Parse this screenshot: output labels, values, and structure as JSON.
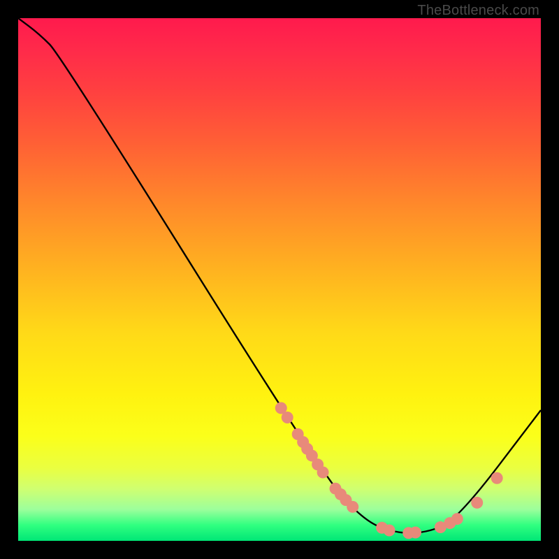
{
  "attribution": "TheBottleneck.com",
  "chart_data": {
    "type": "line",
    "title": "",
    "xlabel": "",
    "ylabel": "",
    "xlim": [
      0,
      100
    ],
    "ylim": [
      0,
      100
    ],
    "curve": [
      {
        "x": 0,
        "y": 100
      },
      {
        "x": 4,
        "y": 97
      },
      {
        "x": 8,
        "y": 93
      },
      {
        "x": 58,
        "y": 13
      },
      {
        "x": 66,
        "y": 4
      },
      {
        "x": 72,
        "y": 1.5
      },
      {
        "x": 78,
        "y": 1.5
      },
      {
        "x": 84,
        "y": 4
      },
      {
        "x": 100,
        "y": 25
      }
    ],
    "points": [
      {
        "x": 50.3,
        "y": 25.4
      },
      {
        "x": 51.5,
        "y": 23.6
      },
      {
        "x": 53.5,
        "y": 20.4
      },
      {
        "x": 54.5,
        "y": 18.9
      },
      {
        "x": 55.3,
        "y": 17.6
      },
      {
        "x": 56.2,
        "y": 16.3
      },
      {
        "x": 57.3,
        "y": 14.6
      },
      {
        "x": 58.3,
        "y": 13.1
      },
      {
        "x": 60.7,
        "y": 10.0
      },
      {
        "x": 61.7,
        "y": 8.9
      },
      {
        "x": 62.7,
        "y": 7.8
      },
      {
        "x": 64.0,
        "y": 6.5
      },
      {
        "x": 69.6,
        "y": 2.5
      },
      {
        "x": 71.0,
        "y": 2.0
      },
      {
        "x": 74.7,
        "y": 1.5
      },
      {
        "x": 76.0,
        "y": 1.6
      },
      {
        "x": 80.8,
        "y": 2.6
      },
      {
        "x": 82.6,
        "y": 3.4
      },
      {
        "x": 84.0,
        "y": 4.2
      },
      {
        "x": 87.8,
        "y": 7.3
      },
      {
        "x": 91.6,
        "y": 12.0
      }
    ],
    "point_color": "#e88a7a",
    "line_color": "#000000"
  }
}
